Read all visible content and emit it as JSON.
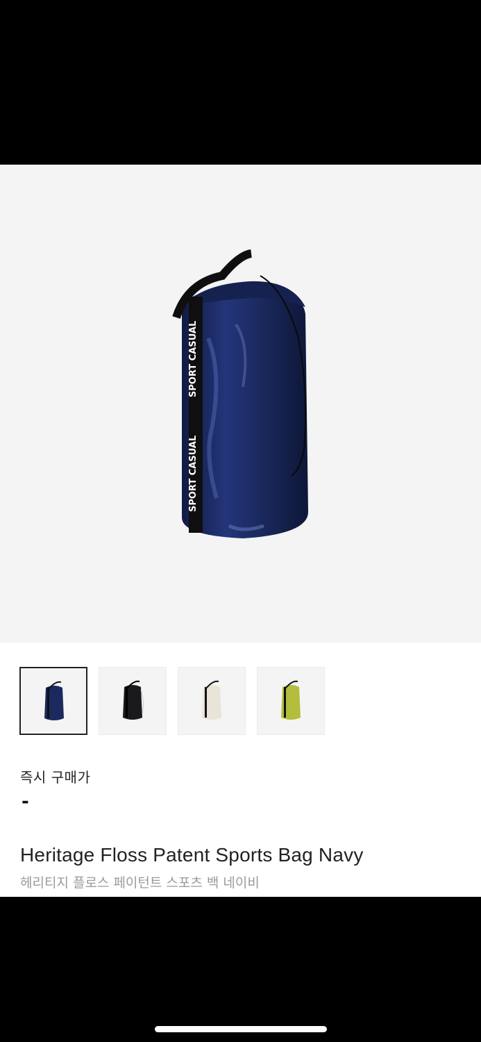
{
  "product": {
    "hero_image": "navy-drawstring-bag-photo",
    "strap_text": "SPORT CASUAL",
    "name_en": "Heritage Floss Patent Sports Bag Navy",
    "name_ko": "헤리티지 플로스 페이턴트 스포츠 백 네이비"
  },
  "thumbnails": [
    {
      "color_name": "navy",
      "color": "#1b2a5e",
      "selected": true
    },
    {
      "color_name": "black",
      "color": "#1a1a1e",
      "selected": false
    },
    {
      "color_name": "ivory",
      "color": "#e9e4d8",
      "selected": false
    },
    {
      "color_name": "lime",
      "color": "#b4bd3c",
      "selected": false
    }
  ],
  "price": {
    "label": "즉시 구매가",
    "value": "-"
  },
  "colors": {
    "hero_bg": "#f4f4f4",
    "bag_navy": "#1b2a5e",
    "strap": "#111111",
    "text_primary": "#222222",
    "text_secondary": "#9a9a9a"
  }
}
